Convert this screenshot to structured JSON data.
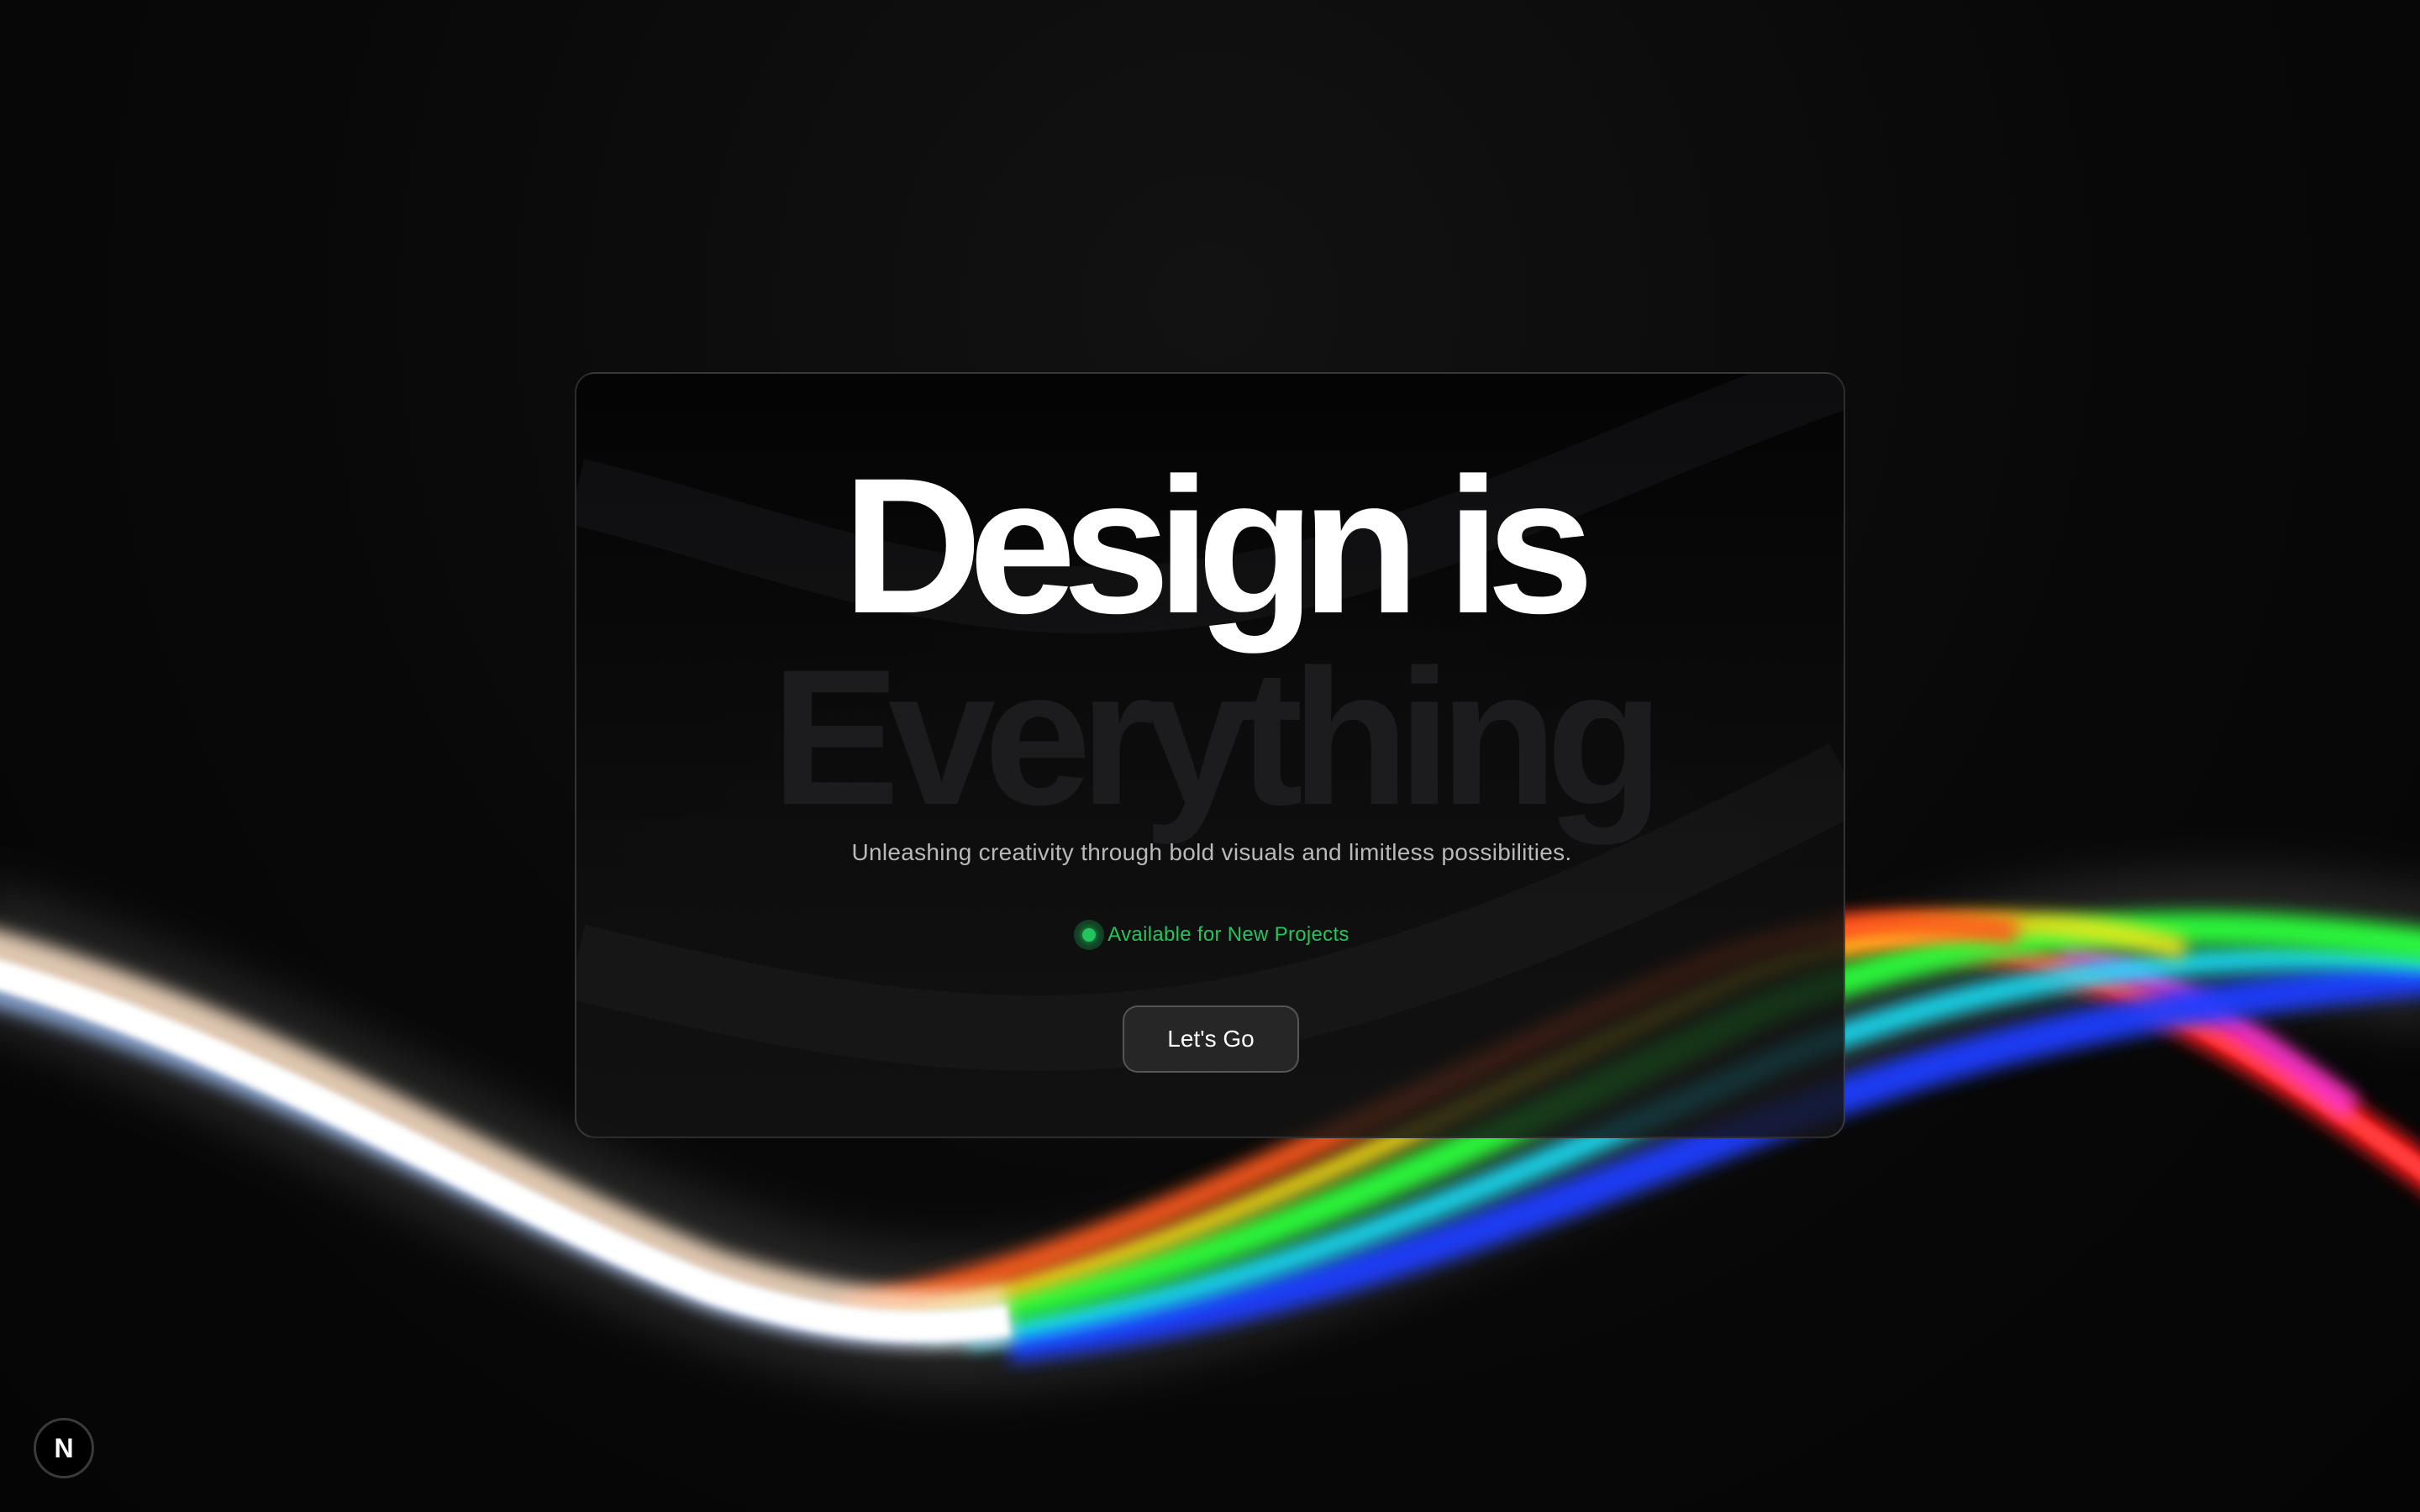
{
  "hero": {
    "headline_line1": "Design is",
    "headline_line2": "Everything",
    "subtitle": "Unleashing creativity through bold visuals and limitless possibilities.",
    "status_text": "Available for New Projects",
    "cta_label": "Let's Go"
  },
  "badge": {
    "letter": "N",
    "icon": "nextjs-logo-icon"
  },
  "colors": {
    "background": "#0a0a0a",
    "status": "#22c55e",
    "headline": "#ffffff",
    "ghost_headline": "#1c1c1e",
    "button_bg": "#262626"
  }
}
